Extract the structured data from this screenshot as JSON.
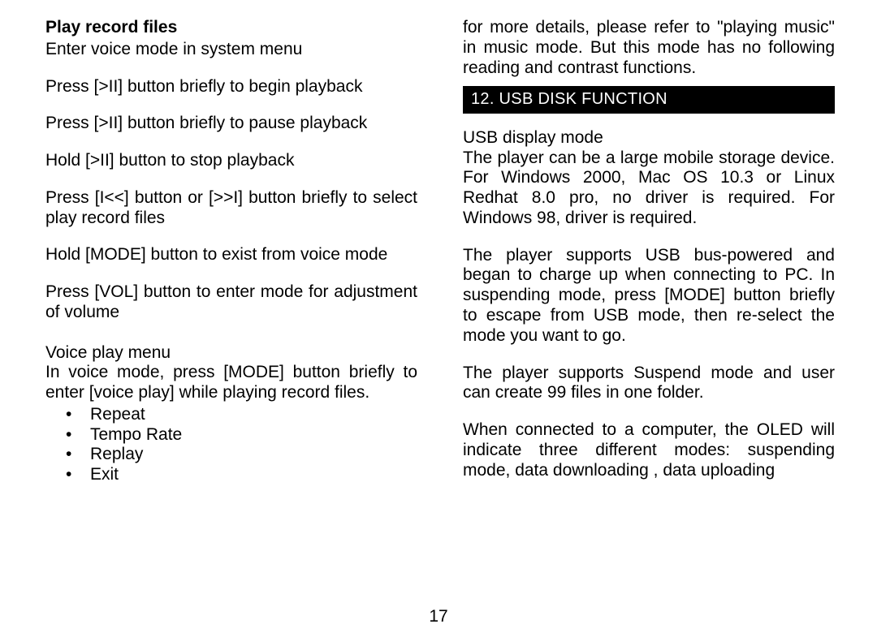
{
  "left": {
    "heading": "Play record files",
    "p1": "Enter voice mode in system menu",
    "p2": "Press [>II] button briefly to begin playback",
    "p3": "Press [>II] button briefly to pause playback",
    "p4": "Hold [>II] button to stop playback",
    "p5": "Press [I<<] button or [>>I] button briefly to select play record files",
    "p6": "Hold [MODE] button to exist from voice mode",
    "p7": "Press [VOL] button to enter  mode for adjustment of volume",
    "p8a": "Voice play menu",
    "p8b": "In voice mode, press [MODE] button briefly to enter [voice play] while playing record files.",
    "menu": [
      "Repeat",
      "Tempo Rate",
      "Replay",
      "Exit"
    ]
  },
  "right": {
    "p1": "for more details, please refer to \"playing music\" in music mode. But this mode has no following reading and contrast functions.",
    "sectionTitle": "12. USB DISK FUNCTION",
    "p2a": "USB display mode",
    "p2b": "The player can be a large mobile storage device. For Windows 2000, Mac OS 10.3 or Linux Redhat 8.0 pro, no driver is required. For Windows 98, driver is required.",
    "p3": "The player supports USB bus-powered and began to charge up when connecting to PC. In suspending mode, press [MODE] button briefly to escape from USB mode, then re-select the mode you want to go.",
    "p4": "The player supports Suspend mode and user can create 99 files in one folder.",
    "p5": "When connected to a computer, the OLED will indicate three different modes: suspending mode, data downloading , data uploading"
  },
  "pageNumber": "17"
}
